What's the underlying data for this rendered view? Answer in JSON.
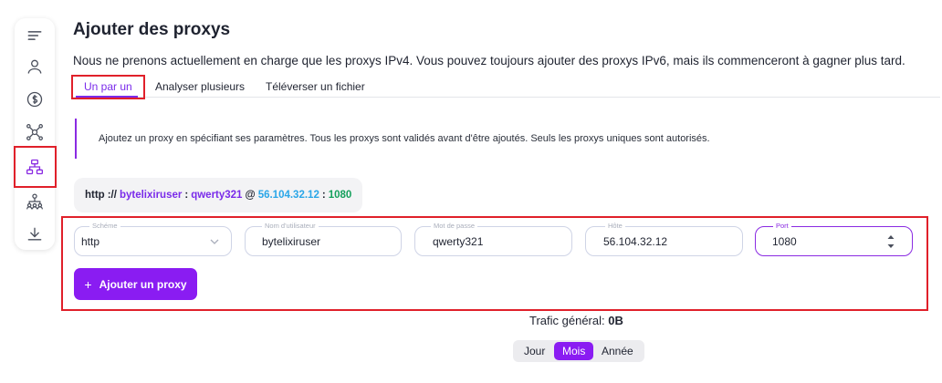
{
  "sidebar": {
    "items": [
      {
        "icon": "menu-lines-icon"
      },
      {
        "icon": "user-icon"
      },
      {
        "icon": "dollar-icon"
      },
      {
        "icon": "network-nodes-icon"
      },
      {
        "icon": "sitemap-icon",
        "active": true
      },
      {
        "icon": "team-hierarchy-icon"
      },
      {
        "icon": "download-icon"
      }
    ],
    "active_color": "#8a2be2"
  },
  "page": {
    "title": "Ajouter des proxys",
    "subtitle": "Nous ne prenons actuellement en charge que les proxys IPv4. Vous pouvez toujours ajouter des proxys IPv6, mais ils commenceront à gagner plus tard."
  },
  "tabs": [
    {
      "label": "Un par un",
      "active": true
    },
    {
      "label": "Analyser plusieurs"
    },
    {
      "label": "Téléverser un fichier"
    }
  ],
  "info": "Ajoutez un proxy en spécifiant ses paramètres. Tous les proxys sont validés avant d'être ajoutés. Seuls les proxys uniques sont autorisés.",
  "preview": {
    "scheme": "http",
    "sep1": "://",
    "user": "bytelixiruser",
    "colon1": ":",
    "password": "qwerty321",
    "at": "@",
    "host": "56.104.32.12",
    "colon2": ":",
    "port": "1080"
  },
  "form": {
    "scheme": {
      "label": "Schéme",
      "value": "http"
    },
    "username": {
      "label": "Nom d'utilisateur",
      "value": "bytelixiruser"
    },
    "password": {
      "label": "Mot de passe",
      "value": "qwerty321"
    },
    "host": {
      "label": "Hôte",
      "value": "56.104.32.12"
    },
    "port": {
      "label": "Port",
      "value": "1080"
    },
    "add_button": "Ajouter un proxy",
    "add_icon": "+"
  },
  "traffic": {
    "label": "Trafic général:",
    "value": "0B"
  },
  "period": {
    "options": [
      "Jour",
      "Mois",
      "Année"
    ],
    "selected": "Mois"
  },
  "colors": {
    "accent": "#8a1cf2",
    "highlight": "#e0202a",
    "host": "#2aa6e8",
    "port": "#14a05c"
  }
}
